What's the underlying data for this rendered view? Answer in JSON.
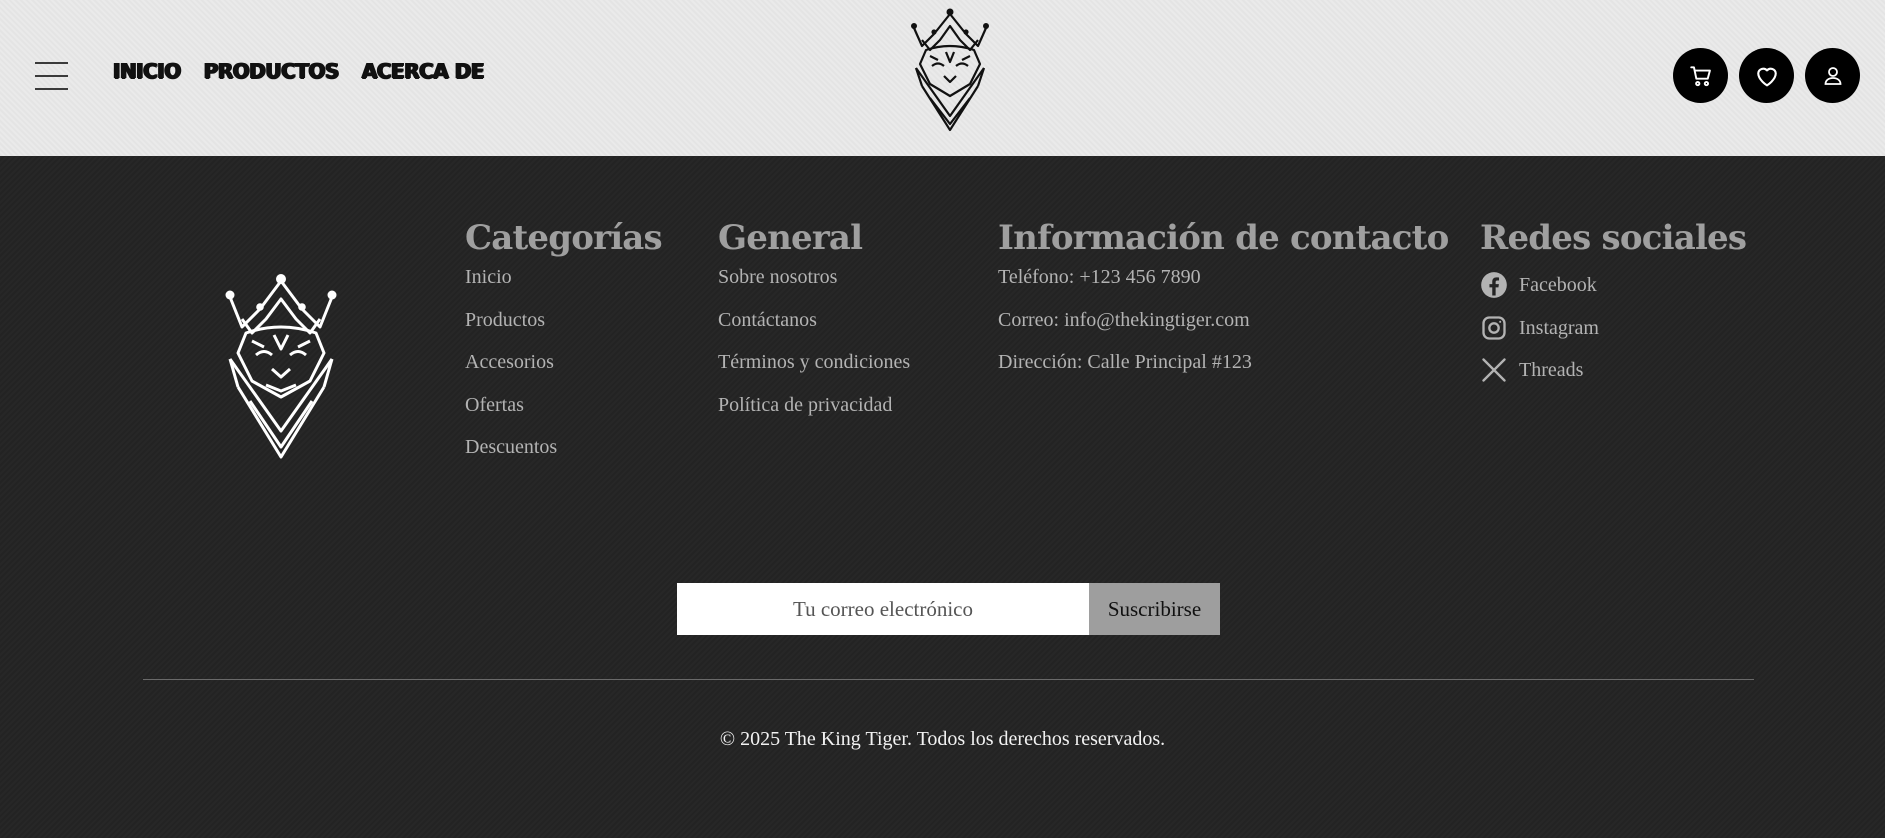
{
  "header": {
    "nav": [
      {
        "label": "INICIO"
      },
      {
        "label": "PRODUCTOS"
      },
      {
        "label": "ACERCA DE"
      }
    ],
    "icons": [
      "menu-icon",
      "tiger-crown-logo",
      "cart-icon",
      "heart-icon",
      "user-icon"
    ]
  },
  "footer": {
    "categorias": {
      "title": "Categorías",
      "items": [
        "Inicio",
        "Productos",
        "Accesorios",
        "Ofertas",
        "Descuentos"
      ]
    },
    "general": {
      "title": "General",
      "items": [
        "Sobre nosotros",
        "Contáctanos",
        "Términos y condiciones",
        "Política de privacidad"
      ]
    },
    "contacto": {
      "title": "Información de contacto",
      "items": [
        "Teléfono: +123 456 7890",
        "Correo: info@thekingtiger.com",
        "Dirección: Calle Principal #123"
      ]
    },
    "redes": {
      "title": "Redes sociales",
      "items": [
        {
          "label": "Facebook",
          "icon": "facebook-icon"
        },
        {
          "label": "Instagram",
          "icon": "instagram-icon"
        },
        {
          "label": "Threads",
          "icon": "x-icon"
        }
      ]
    },
    "subscribe": {
      "placeholder": "Tu correo electrónico",
      "button": "Suscribirse"
    },
    "copyright": "© 2025 The King Tiger. Todos los derechos reservados."
  },
  "colors": {
    "header_bg": "#e9e9e9",
    "footer_bg": "#242424",
    "heading": "#9f9f9f",
    "link": "#b3b3b3",
    "button_bg": "#9e9e9e"
  }
}
